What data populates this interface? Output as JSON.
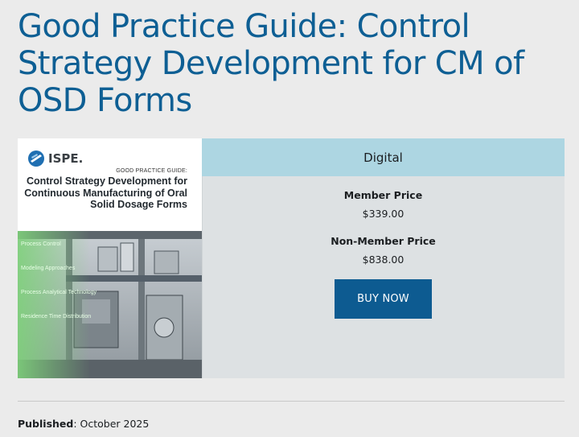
{
  "page": {
    "title": "Good Practice Guide: Control Strategy Development for CM of OSD Forms"
  },
  "cover": {
    "logo_text": "ISPE.",
    "kicker": "GOOD PRACTICE GUIDE:",
    "title": "Control Strategy Development for Continuous Manufacturing of Oral Solid Dosage Forms",
    "image_labels": [
      "Process Control",
      "Modeling Approaches",
      "Process Analytical Technology",
      "Residence Time Distribution"
    ]
  },
  "product": {
    "tab_label": "Digital",
    "member_price_label": "Member Price",
    "member_price": "$339.00",
    "nonmember_price_label": "Non-Member Price",
    "nonmember_price": "$838.00",
    "buy_label": "BUY NOW"
  },
  "meta": {
    "published_label": "Published",
    "published_value": "October 2025"
  },
  "colors": {
    "title": "#0e5f94",
    "tab_bar": "#add6e2",
    "panel": "#dde1e3",
    "button": "#0d5b91",
    "page_bg": "#ebebeb"
  }
}
